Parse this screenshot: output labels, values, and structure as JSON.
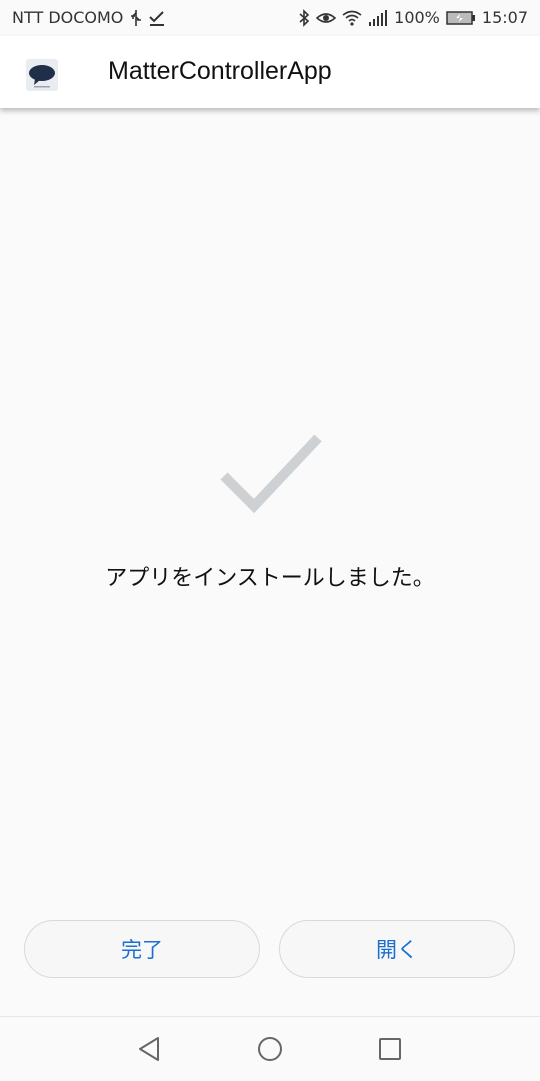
{
  "status_bar": {
    "carrier": "NTT DOCOMO",
    "battery": "100%",
    "time": "15:07",
    "icons": [
      "usb-icon",
      "check-download-icon",
      "bluetooth-icon",
      "eye-icon",
      "wifi-icon",
      "signal-icon",
      "battery-icon"
    ]
  },
  "header": {
    "title": "MatterControllerApp",
    "app_icon": "app-icon"
  },
  "main": {
    "icon": "checkmark-icon",
    "message": "アプリをインストールしました。"
  },
  "buttons": {
    "done_label": "完了",
    "open_label": "開く"
  },
  "nav": {
    "icons": [
      "back-icon",
      "home-icon",
      "recent-apps-icon"
    ]
  },
  "colors": {
    "accent": "#1a6fd1",
    "checkmark": "#cdd1d4",
    "background": "#fafafa"
  }
}
